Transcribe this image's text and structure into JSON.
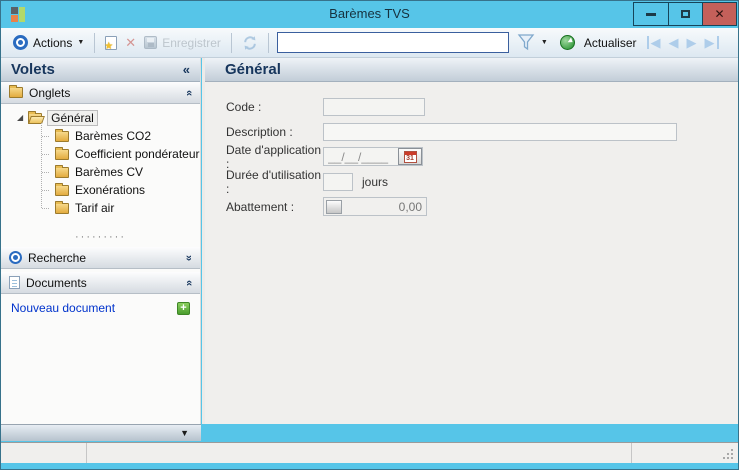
{
  "window": {
    "title": "Barèmes TVS",
    "controls": {
      "close": "✕"
    }
  },
  "toolbar": {
    "actions_label": "Actions",
    "save_label": "Enregistrer",
    "refresh_label": "Actualiser",
    "search_value": ""
  },
  "sidebar": {
    "title": "Volets",
    "sections": {
      "onglets": "Onglets",
      "recherche": "Recherche",
      "documents": "Documents"
    },
    "tree": {
      "root": "Général",
      "children": [
        "Barèmes CO2",
        "Coefficient pondérateur",
        "Barèmes CV",
        "Exonérations",
        "Tarif air"
      ]
    },
    "new_document_label": "Nouveau document"
  },
  "main": {
    "header": "Général",
    "fields": [
      {
        "label": "Code :",
        "value": ""
      },
      {
        "label": "Description :",
        "value": ""
      },
      {
        "label": "Date d'application :",
        "value": "__/__/____",
        "calendar_day": "31"
      },
      {
        "label": "Durée d'utilisation :",
        "value": "",
        "suffix": "jours"
      },
      {
        "label": "Abattement :",
        "value": "0,00"
      }
    ]
  },
  "icons": {
    "collapse_left": "«",
    "chevron_double": "«",
    "dropdown_caret": "▼",
    "overflow_caret": "▼",
    "tree_expander": "◢",
    "nav_first": "◀",
    "nav_prev": "◀",
    "nav_next": "▶",
    "nav_last": "▶",
    "delete_glyph": "✕",
    "star_glyph": "★",
    "plus_glyph": "+",
    "splitter_dots": "·········"
  },
  "colors": {
    "titlebar": "#56c5e8",
    "close_button": "#c4605a",
    "header_text": "#17365d",
    "link_text": "#0033cc",
    "folder": "#e8b84d",
    "actualiser_green": "#2e9e3a",
    "toolbar_blue": "#2a6bc0"
  }
}
